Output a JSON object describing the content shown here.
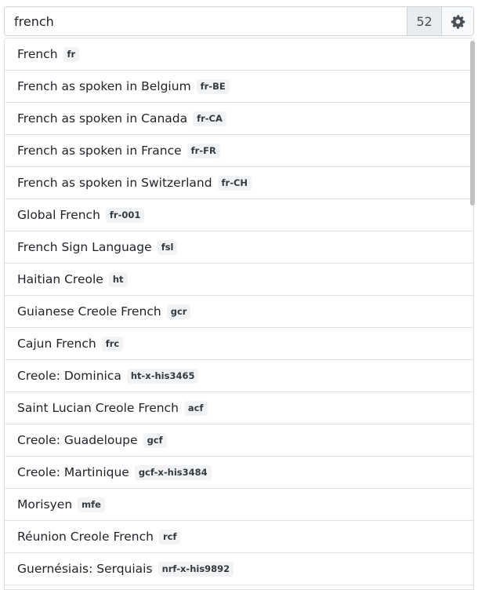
{
  "search": {
    "value": "french",
    "result_count": "52",
    "settings_icon": "gear-icon"
  },
  "results": [
    {
      "name": "French",
      "code": "fr"
    },
    {
      "name": "French as spoken in Belgium",
      "code": "fr-BE"
    },
    {
      "name": "French as spoken in Canada",
      "code": "fr-CA"
    },
    {
      "name": "French as spoken in France",
      "code": "fr-FR"
    },
    {
      "name": "French as spoken in Switzerland",
      "code": "fr-CH"
    },
    {
      "name": "Global French",
      "code": "fr-001"
    },
    {
      "name": "French Sign Language",
      "code": "fsl"
    },
    {
      "name": "Haitian Creole",
      "code": "ht"
    },
    {
      "name": "Guianese Creole French",
      "code": "gcr"
    },
    {
      "name": "Cajun French",
      "code": "frc"
    },
    {
      "name": "Creole: Dominica",
      "code": "ht-x-his3465"
    },
    {
      "name": "Saint Lucian Creole French",
      "code": "acf"
    },
    {
      "name": "Creole: Guadeloupe",
      "code": "gcf"
    },
    {
      "name": "Creole: Martinique",
      "code": "gcf-x-his3484"
    },
    {
      "name": "Morisyen",
      "code": "mfe"
    },
    {
      "name": "Réunion Creole French",
      "code": "rcf"
    },
    {
      "name": "Guernésiais: Serquiais",
      "code": "nrf-x-his9892"
    },
    {
      "name": "",
      "code": ""
    }
  ]
}
